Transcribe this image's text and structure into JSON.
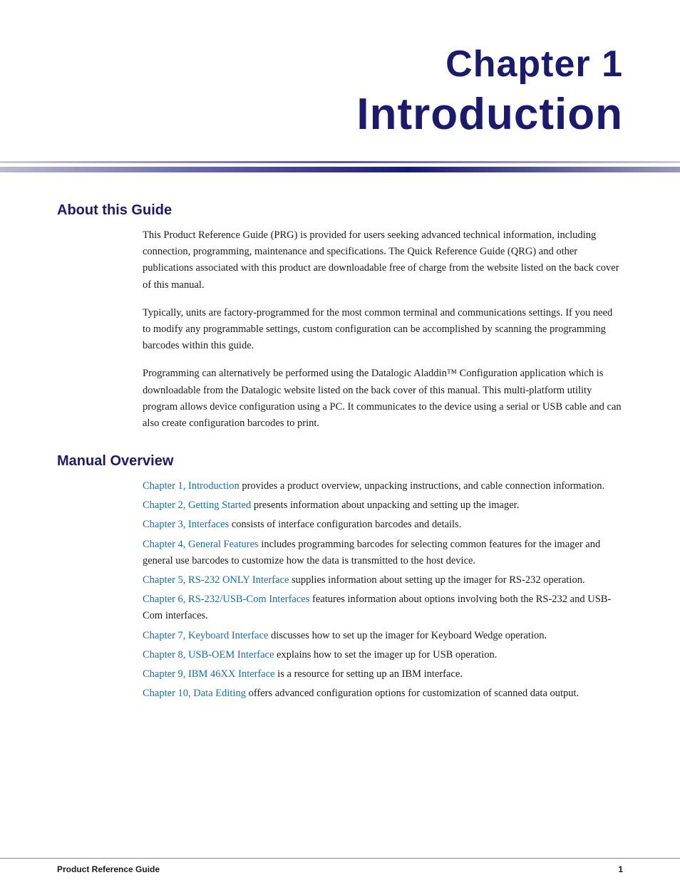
{
  "chapter": {
    "label": "Chapter 1",
    "title": "Introduction"
  },
  "sections": {
    "about": {
      "heading": "About this Guide",
      "paragraphs": [
        "This Product Reference Guide (PRG) is provided for users seeking advanced technical information, including connection, programming, maintenance and specifications. The Quick Reference Guide (QRG) and other publications associated with this product are downloadable free of charge from the website listed on the back cover of this manual.",
        "Typically, units are factory-programmed for the most common terminal and communications settings. If you need to modify any programmable settings, custom configuration can be accomplished by scanning the programming barcodes within this guide.",
        "Programming can alternatively be performed using the Datalogic Aladdin™ Configuration application which is downloadable from the Datalogic website listed on the back cover of this manual. This multi-platform utility program allows device configuration using a PC. It communicates to the device using a serial or USB cable and can also create configuration barcodes to print."
      ]
    },
    "manual_overview": {
      "heading": "Manual Overview",
      "items": [
        {
          "link": "Chapter 1, Introduction",
          "text": " provides a product overview, unpacking instructions, and cable connection information."
        },
        {
          "link": "Chapter 2, Getting Started",
          "text": " presents information about unpacking and setting up the imager."
        },
        {
          "link": "Chapter 3, Interfaces",
          "text": " consists of interface configuration barcodes and details."
        },
        {
          "link": "Chapter 4, General Features",
          "text": " includes programming barcodes for selecting common features for the imager and general use barcodes to customize how the data is transmitted to the host device."
        },
        {
          "link": "Chapter 5, RS-232 ONLY Interface",
          "text": " supplies information about setting up the imager for RS-232 operation."
        },
        {
          "link": "Chapter 6, RS-232/USB-Com Interfaces",
          "text": " features information about options involving both the RS-232 and USB-Com interfaces."
        },
        {
          "link": "Chapter 7, Keyboard Interface",
          "text": " discusses how to set up the imager for Keyboard Wedge operation."
        },
        {
          "link": "Chapter 8, USB-OEM Interface",
          "text": " explains how to set the imager up for USB operation."
        },
        {
          "link": "Chapter 9, IBM 46XX Interface",
          "text": " is a resource for setting up an IBM interface."
        },
        {
          "link": "Chapter 10, Data Editing",
          "text": " offers advanced configuration options for customization of scanned data output."
        }
      ]
    }
  },
  "footer": {
    "left": "Product Reference Guide",
    "right": "1"
  }
}
